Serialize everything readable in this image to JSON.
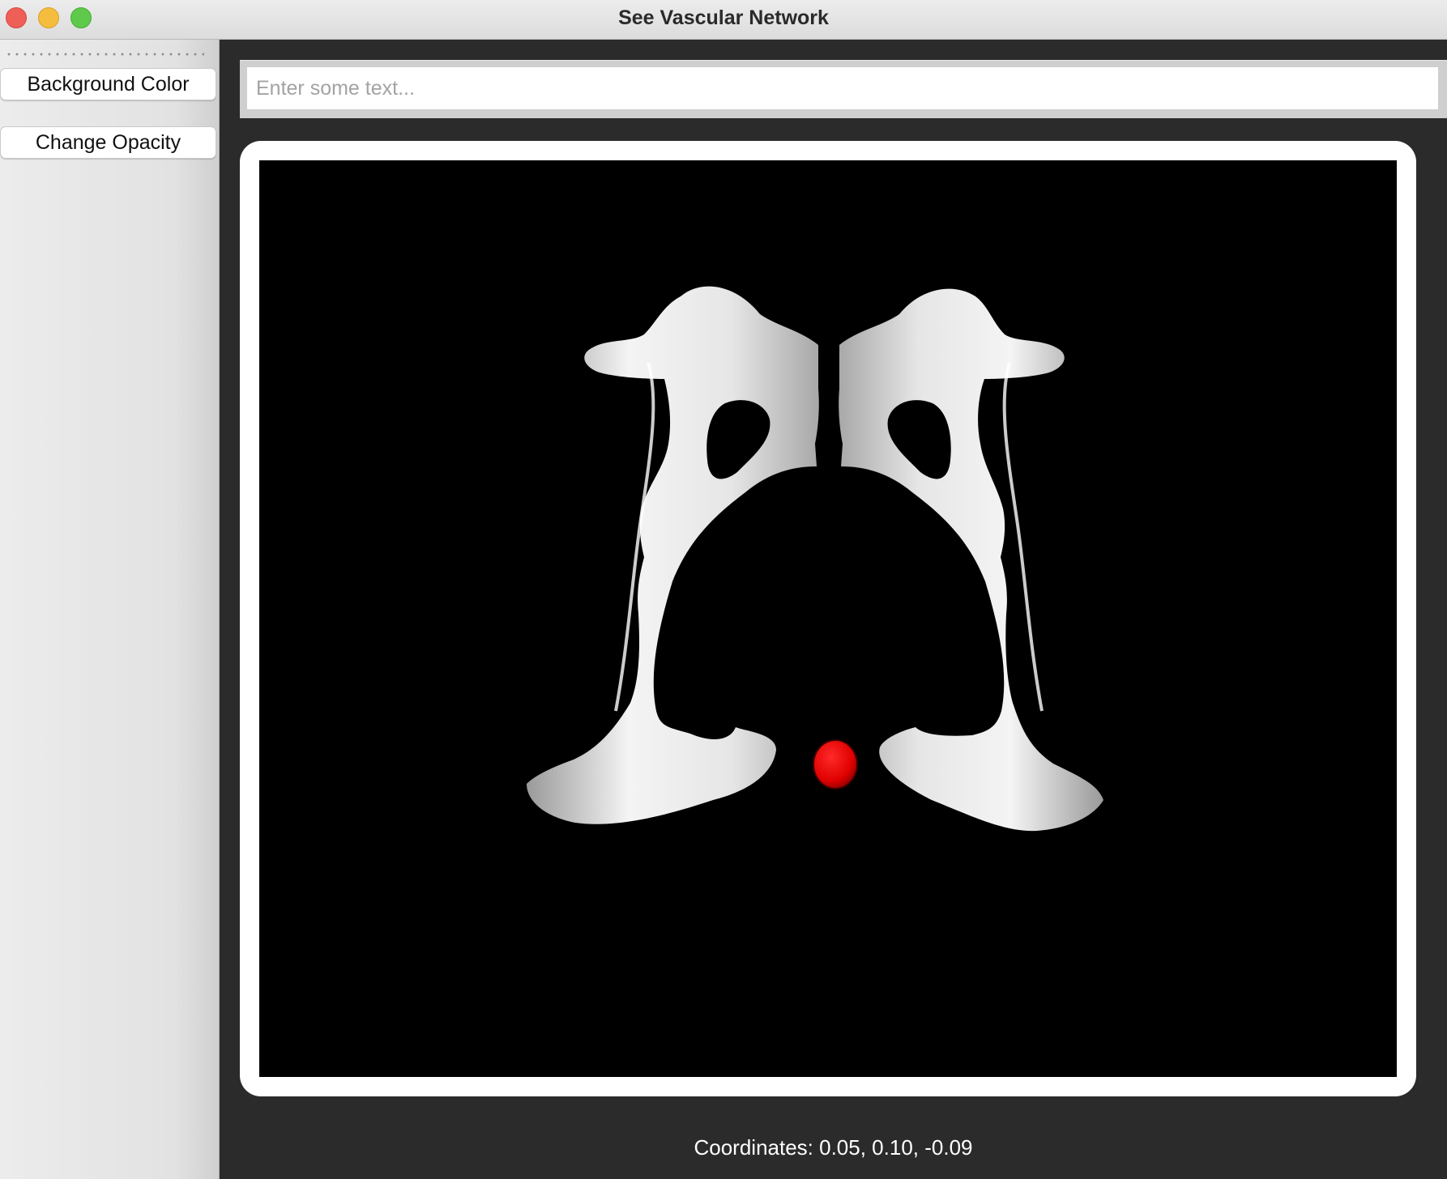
{
  "window": {
    "title": "See Vascular Network"
  },
  "sidebar": {
    "buttons": {
      "background_color": "Background Color",
      "change_opacity": "Change Opacity"
    }
  },
  "main": {
    "text_input": {
      "value": "",
      "placeholder": "Enter some text..."
    },
    "viewer": {
      "background_color": "#000000",
      "model_color": "#f2f2f2",
      "marker_color": "#e60000"
    },
    "status": {
      "coordinates_label": "Coordinates: 0.05, 0.10, -0.09"
    }
  },
  "colors": {
    "close": "#ee5f57",
    "minimize": "#f5bd3d",
    "zoom": "#5fc94b"
  }
}
